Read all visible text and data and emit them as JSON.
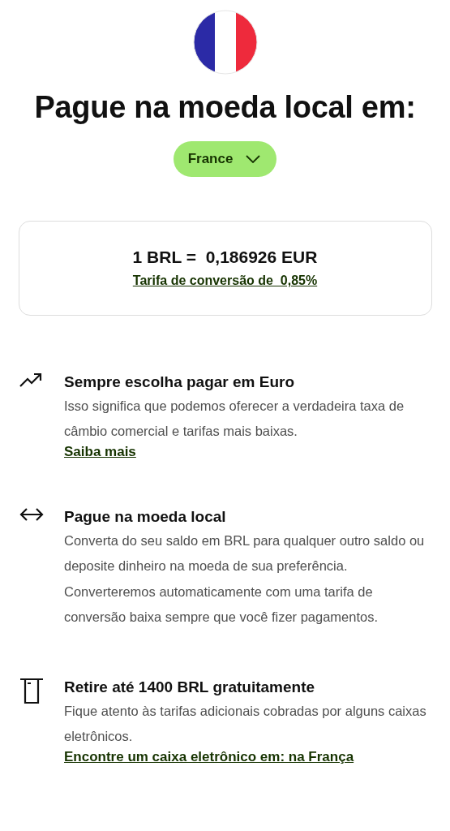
{
  "heading": "Pague na moeda local em:",
  "country_selector": {
    "label": "France"
  },
  "rate_card": {
    "rate": "1 BRL =  0,186926 EUR",
    "fee_link": "Tarifa de conversão de  0,85%"
  },
  "features": [
    {
      "kind": "trend",
      "title": "Sempre escolha pagar em Euro",
      "description": "Isso significa que podemos oferecer a verdadeira taxa de câmbio comercial e tarifas mais baixas.",
      "link": "Saiba mais"
    },
    {
      "kind": "exchange",
      "title": "Pague na moeda local",
      "description": "Converta do seu saldo em BRL para qualquer outro saldo ou deposite dinheiro na moeda de sua preferência. Converteremos automaticamente com uma tarifa de conversão baixa sempre que você fizer pagamentos."
    },
    {
      "kind": "atm",
      "title": "Retire até 1400 BRL gratuitamente",
      "description": "Fique atento às tarifas adicionais cobradas por alguns caixas eletrônicos.",
      "link": "Encontre um caixa eletrônico em: na França"
    }
  ]
}
